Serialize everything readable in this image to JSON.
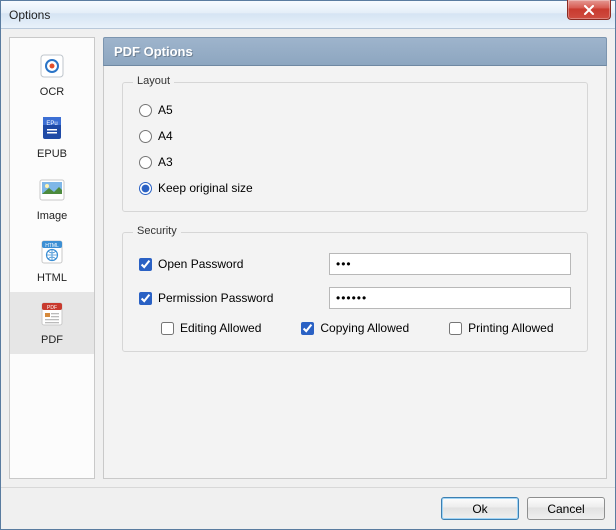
{
  "window": {
    "title": "Options"
  },
  "sidebar": {
    "items": [
      {
        "label": "OCR",
        "selected": false
      },
      {
        "label": "EPUB",
        "selected": false
      },
      {
        "label": "Image",
        "selected": false
      },
      {
        "label": "HTML",
        "selected": false
      },
      {
        "label": "PDF",
        "selected": true
      }
    ]
  },
  "panel": {
    "title": "PDF Options"
  },
  "layout_group": {
    "title": "Layout",
    "options": {
      "a5": "A5",
      "a4": "A4",
      "a3": "A3",
      "keep_original": "Keep original size"
    },
    "selected": "keep_original"
  },
  "security_group": {
    "title": "Security",
    "open_password": {
      "label": "Open Password",
      "checked": true,
      "value": "•••"
    },
    "permission_password": {
      "label": "Permission Password",
      "checked": true,
      "value": "••••••"
    },
    "permissions": {
      "editing": {
        "label": "Editing Allowed",
        "checked": false
      },
      "copying": {
        "label": "Copying Allowed",
        "checked": true
      },
      "printing": {
        "label": "Printing Allowed",
        "checked": false
      }
    }
  },
  "buttons": {
    "ok": "Ok",
    "cancel": "Cancel"
  }
}
